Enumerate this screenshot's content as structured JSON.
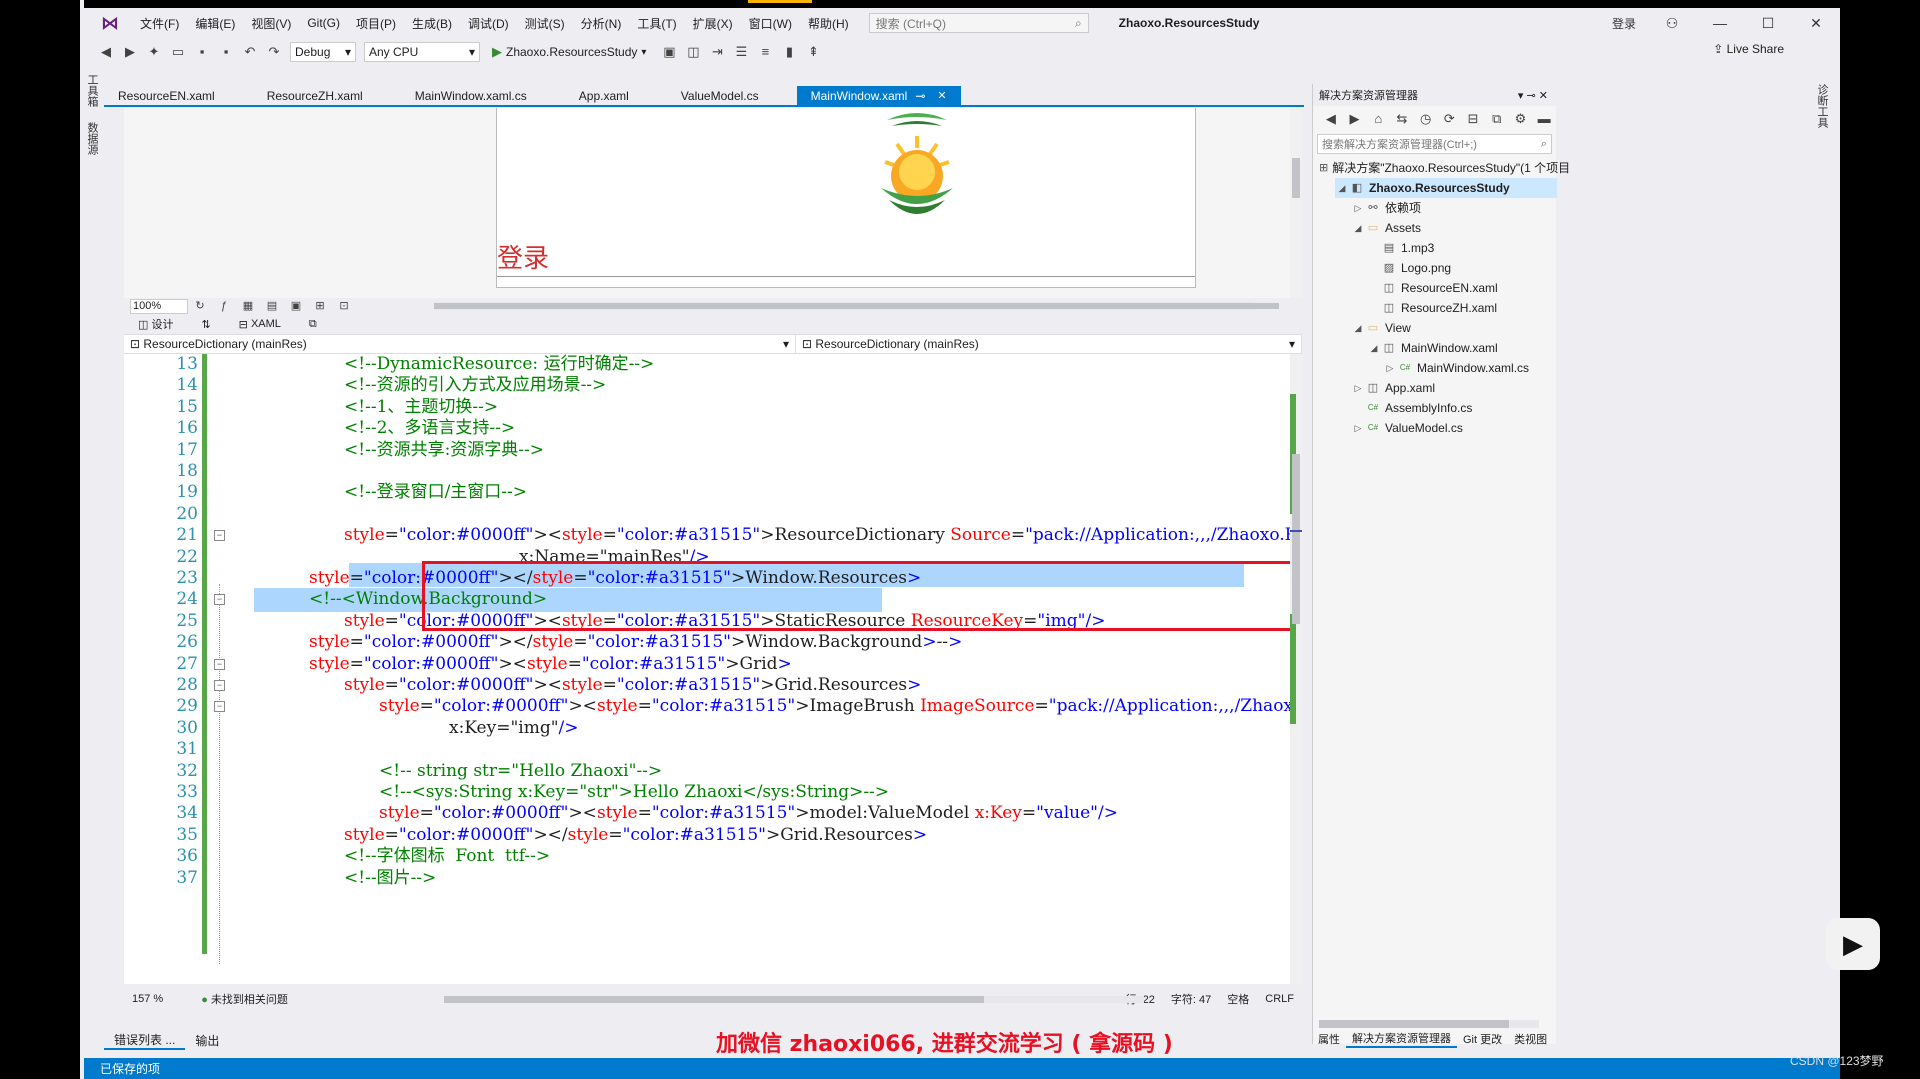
{
  "menu": {
    "items": [
      "文件(F)",
      "编辑(E)",
      "视图(V)",
      "Git(G)",
      "项目(P)",
      "生成(B)",
      "调试(D)",
      "测试(S)",
      "分析(N)",
      "工具(T)",
      "扩展(X)",
      "窗口(W)",
      "帮助(H)"
    ],
    "search_placeholder": "搜索 (Ctrl+Q)",
    "solution_title": "Zhaoxo.ResourcesStudy",
    "login": "登录"
  },
  "toolbar": {
    "config": "Debug",
    "platform": "Any CPU",
    "run_target": "Zhaoxo.ResourcesStudy",
    "live_share": "Live Share"
  },
  "left_vtabs": [
    "工具箱",
    "数据源"
  ],
  "right_vtabs": [
    "诊断工具"
  ],
  "doc_tabs": [
    {
      "label": "ResourceEN.xaml"
    },
    {
      "label": "ResourceZH.xaml"
    },
    {
      "label": "MainWindow.xaml.cs"
    },
    {
      "label": "App.xaml"
    },
    {
      "label": "ValueModel.cs"
    },
    {
      "label": "MainWindow.xaml"
    }
  ],
  "designer": {
    "login_title": "登录",
    "zoom": "100%",
    "design_tab": "设计",
    "xaml_tab": "XAML"
  },
  "navbar": {
    "left": "ResourceDictionary (mainRes)",
    "right": "ResourceDictionary (mainRes)"
  },
  "code": {
    "line_numbers": [
      "13",
      "14",
      "15",
      "16",
      "17",
      "18",
      "19",
      "20",
      "21",
      "22",
      "23",
      "24",
      "25",
      "26",
      "27",
      "28",
      "29",
      "30",
      "31",
      "32",
      "33",
      "34",
      "35",
      "36",
      "37"
    ],
    "lines": [
      "<!--DynamicResource: 运行时确定-->",
      "<!--资源的引入方式及应用场景-->",
      "<!--1、主题切换-->",
      "<!--2、多语言支持-->",
      "<!--资源共享:资源字典-->",
      "",
      "<!--登录窗口/主窗口-->",
      "",
      "<ResourceDictionary Source=\"pack://Application:,,,/Zhaoxo.ResourcesStudy;component/Assets/ResourceZH.xaml\"",
      "x:Name=\"mainRes\"/>",
      "</Window.Resources>",
      "<!--<Window.Background>",
      "<StaticResource ResourceKey=\"img\"/>",
      "</Window.Background>-->",
      "<Grid>",
      "<Grid.Resources>",
      "<ImageBrush ImageSource=\"pack://Application:,,,/Zhaoxo.ResourcesStudy;component/Assets/Logo.png\"",
      "x:Key=\"img\"/>",
      "",
      "<!-- string str=\"Hello Zhaoxi\"-->",
      "<!--<sys:String x:Key=\"str\">Hello Zhaoxi</sys:String>-->",
      "<model:ValueModel x:Key=\"value\"/>",
      "</Grid.Resources>",
      "<!--字体图标  Font  ttf-->",
      "<!--图片-->"
    ]
  },
  "editor_status": {
    "zoom": "157 %",
    "issues": "未找到相关问题",
    "line": "行: 22",
    "char": "字符: 47",
    "space": "空格",
    "eol": "CRLF"
  },
  "bottom_tabs": [
    "错误列表 ...",
    "输出"
  ],
  "promo_text": "加微信 zhaoxi066, 进群交流学习 ( 拿源码 )",
  "status_text": "已保存的项",
  "solution_explorer": {
    "title": "解决方案资源管理器",
    "search_placeholder": "搜索解决方案资源管理器(Ctrl+;)",
    "tree": [
      {
        "label": "解决方案\"Zhaoxo.ResourcesStudy\"(1 个项目",
        "icon": "solution-icon",
        "indent": 0,
        "twisty": ""
      },
      {
        "label": "Zhaoxo.ResourcesStudy",
        "icon": "project-icon",
        "indent": 1,
        "twisty": "◢"
      },
      {
        "label": "依赖项",
        "icon": "dependencies-icon",
        "indent": 2,
        "twisty": "▷"
      },
      {
        "label": "Assets",
        "icon": "folder-icon",
        "indent": 2,
        "twisty": "◢"
      },
      {
        "label": "1.mp3",
        "icon": "file-icon",
        "indent": 3,
        "twisty": ""
      },
      {
        "label": "Logo.png",
        "icon": "image-icon",
        "indent": 3,
        "twisty": ""
      },
      {
        "label": "ResourceEN.xaml",
        "icon": "xaml-icon",
        "indent": 3,
        "twisty": ""
      },
      {
        "label": "ResourceZH.xaml",
        "icon": "xaml-icon",
        "indent": 3,
        "twisty": ""
      },
      {
        "label": "View",
        "icon": "folder-icon",
        "indent": 2,
        "twisty": "◢"
      },
      {
        "label": "MainWindow.xaml",
        "icon": "xaml-icon",
        "indent": 3,
        "twisty": "◢"
      },
      {
        "label": "MainWindow.xaml.cs",
        "icon": "csharp-icon",
        "indent": 4,
        "twisty": "▷"
      },
      {
        "label": "App.xaml",
        "icon": "xaml-icon",
        "indent": 2,
        "twisty": "▷"
      },
      {
        "label": "AssemblyInfo.cs",
        "icon": "csharp-icon",
        "indent": 2,
        "twisty": ""
      },
      {
        "label": "ValueModel.cs",
        "icon": "csharp-icon",
        "indent": 2,
        "twisty": "▷"
      }
    ],
    "bottom_tabs": [
      "属性",
      "解决方案资源管理器",
      "Git 更改",
      "类视图"
    ]
  },
  "watermark": "CSDN @123梦野",
  "colors": {
    "accent": "#007acc",
    "comment": "#008000",
    "element": "#a31515",
    "attribute": "#ff0000",
    "value": "#0000ff",
    "highlight_box": "#e81123",
    "selection": "#add6ff",
    "promo": "#e81123"
  }
}
